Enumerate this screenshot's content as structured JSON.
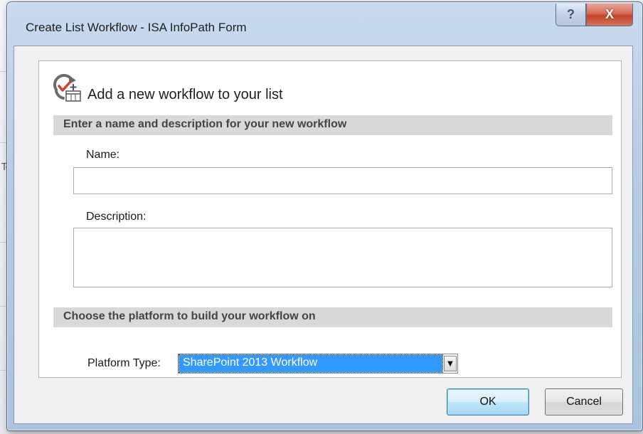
{
  "window": {
    "title": "Create List Workflow - ISA InfoPath Form",
    "help_glyph": "?",
    "close_glyph": "X"
  },
  "background": {
    "fragment_text": "Te"
  },
  "dialog": {
    "heading": "Add a new workflow to your list",
    "section_name_description": "Enter a name and description for your new workflow",
    "name_label": "Name:",
    "name_value": "",
    "description_label": "Description:",
    "description_value": "",
    "section_platform": "Choose the platform to build your workflow on",
    "platform_label": "Platform Type:",
    "platform_selected": "SharePoint 2013 Workflow",
    "ok_label": "OK",
    "cancel_label": "Cancel"
  },
  "icons": {
    "heading_icon": "add-workflow-icon",
    "dropdown_arrow": "chevron-down-icon"
  },
  "colors": {
    "selection": "#3399ff",
    "section_band": "#d9d9d9",
    "close_button": "#c3442c"
  }
}
